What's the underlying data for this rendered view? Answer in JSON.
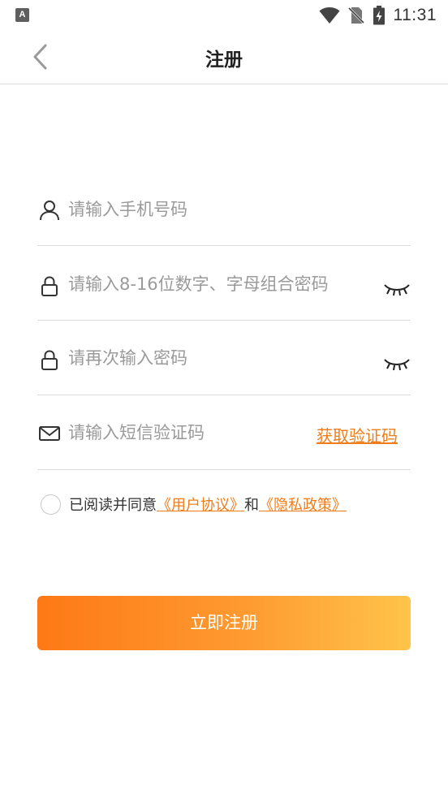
{
  "status_bar": {
    "app_icon_letter": "A",
    "time": "11:31"
  },
  "header": {
    "title": "注册"
  },
  "form": {
    "phone": {
      "placeholder": "请输入手机号码",
      "value": ""
    },
    "password": {
      "placeholder": "请输入8-16位数字、字母组合密码",
      "value": ""
    },
    "confirm_password": {
      "placeholder": "请再次输入密码",
      "value": ""
    },
    "sms_code": {
      "placeholder": "请输入短信验证码",
      "value": "",
      "get_code_label": "获取验证码"
    }
  },
  "agreement": {
    "prefix": "已阅读并同意",
    "user_agreement": "《用户协议》",
    "conjunction": "和",
    "privacy_policy": "《隐私政策》",
    "checked": false
  },
  "submit": {
    "label": "立即注册"
  },
  "colors": {
    "accent": "#f07d1a",
    "button_gradient_start": "#fd7916",
    "button_gradient_end": "#ffc44a"
  }
}
